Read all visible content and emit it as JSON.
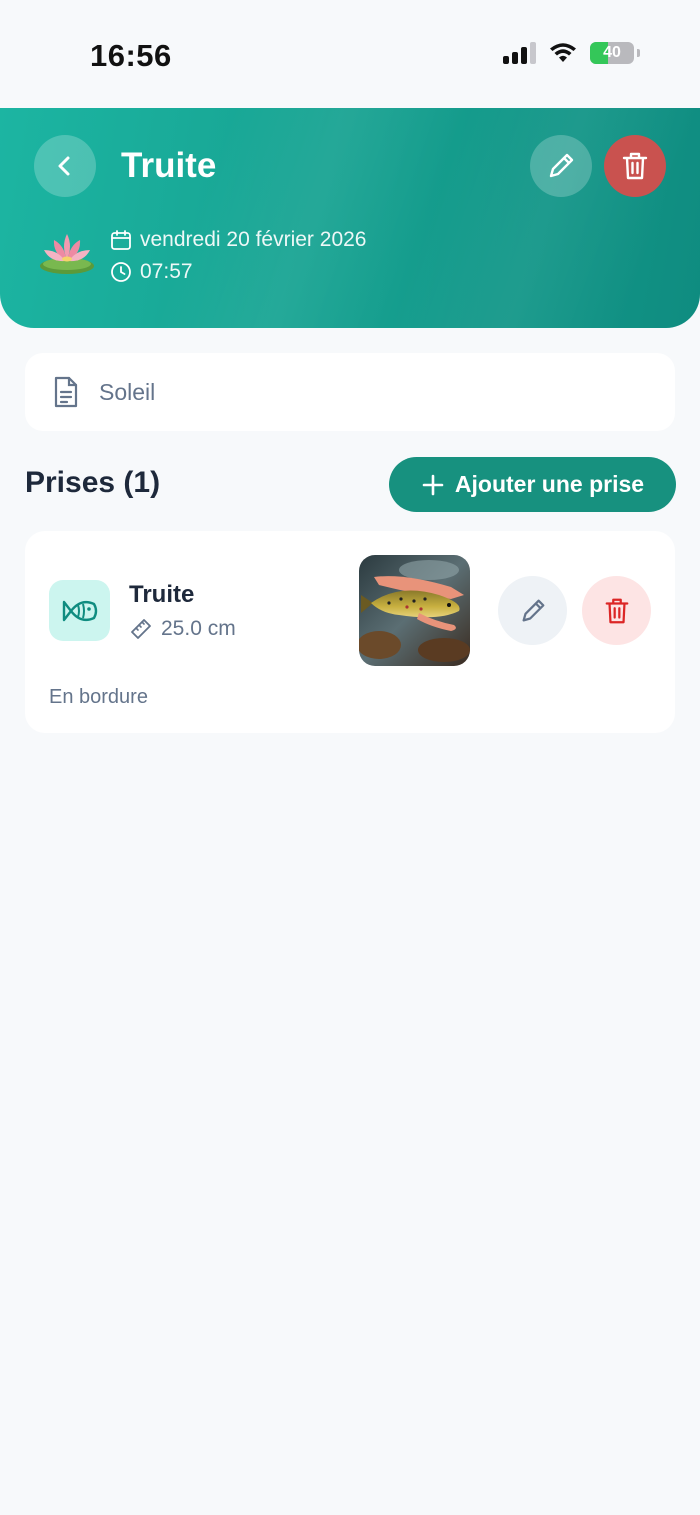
{
  "status_bar": {
    "time": "16:56",
    "battery": "40",
    "icons": [
      "cellular-signal-icon",
      "wifi-icon",
      "battery-charging-icon"
    ]
  },
  "header": {
    "title": "Truite",
    "date": "vendredi 20 février 2026",
    "time": "07:57",
    "icons": [
      "back-chevron-icon",
      "pencil-icon",
      "trash-icon",
      "lotus-icon",
      "calendar-icon",
      "clock-icon"
    ],
    "colors": {
      "gradient_start": "#1cb5a2",
      "gradient_end": "#0f8c80",
      "delete": "#c9524f"
    }
  },
  "notes": {
    "text": "Soleil",
    "icon": "document-icon"
  },
  "catches_section": {
    "title": "Prises (1)",
    "add_button_label": "Ajouter une prise",
    "add_icon": "plus-icon",
    "accent": "#17917f"
  },
  "catches": [
    {
      "species": "Truite",
      "size": "25.0 cm",
      "note": "En bordure",
      "icons": [
        "fish-icon",
        "ruler-icon",
        "pencil-icon",
        "trash-icon"
      ]
    }
  ]
}
